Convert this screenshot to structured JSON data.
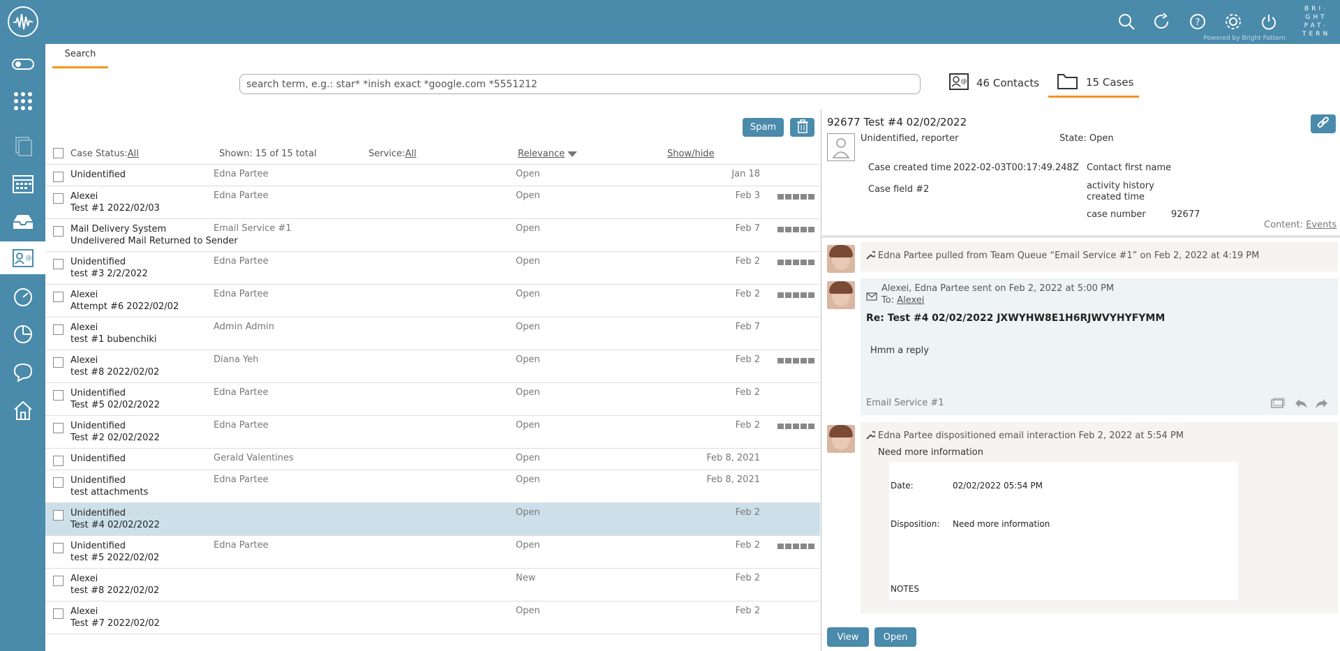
{
  "topbar": {
    "icons": [
      "search-icon",
      "refresh-icon",
      "help-icon",
      "settings-icon",
      "power-icon"
    ],
    "powered_by": "Powered by Bright Pattern",
    "brand_lines": [
      "BRI",
      "·",
      "GHT",
      "PAT",
      "·",
      "TERN"
    ],
    "brand_text": "BRI·GHT PAT·TERN"
  },
  "sidebar": {
    "items": [
      "toggle-icon",
      "apps-grid-icon",
      "documents-icon",
      "calendar-icon",
      "inbox-icon",
      "contacts-icon",
      "dashboard-icon",
      "reports-icon",
      "chat-icon",
      "home-icon"
    ]
  },
  "tabs": {
    "search": "Search"
  },
  "search": {
    "placeholder": "search term, e.g.: star* *inish exact *google.com *5551212"
  },
  "counts": {
    "contacts": "46 Contacts",
    "cases": "15 Cases"
  },
  "toolbar": {
    "spam": "Spam"
  },
  "list_header": {
    "case_status_label": "Case Status:",
    "case_status_value": "All",
    "shown": "Shown: 15 of 15 total",
    "service_label": "Service:",
    "service_value": "All",
    "relevance": "Relevance",
    "show_hide": "Show/hide"
  },
  "rows": [
    {
      "name": "Unidentified",
      "subject": "",
      "agent": "Edna Partee",
      "status": "Open",
      "date": "Jan 18",
      "bars": false
    },
    {
      "name": "Alexei",
      "subject": "Test #1 2022/02/03",
      "agent": "Edna Partee",
      "status": "Open",
      "date": "Feb 3",
      "bars": true
    },
    {
      "name": "Mail Delivery System",
      "subject": "Undelivered Mail Returned to Sender",
      "agent": "Email Service #1",
      "status": "Open",
      "date": "Feb 7",
      "bars": true
    },
    {
      "name": "Unidentified",
      "subject": "test #3 2/2/2022",
      "agent": "Edna Partee",
      "status": "Open",
      "date": "Feb 2",
      "bars": true
    },
    {
      "name": "Alexei",
      "subject": "Attempt #6 2022/02/02",
      "agent": "Edna Partee",
      "status": "Open",
      "date": "Feb 2",
      "bars": true
    },
    {
      "name": "Alexei",
      "subject": "test #1 bubenchiki",
      "agent": "Admin Admin",
      "status": "Open",
      "date": "Feb 7",
      "bars": false
    },
    {
      "name": "Alexei",
      "subject": "test #8 2022/02/02",
      "agent": "Diana Yeh",
      "status": "Open",
      "date": "Feb 2",
      "bars": true
    },
    {
      "name": "Unidentified",
      "subject": "Test #5 02/02/2022",
      "agent": "Edna Partee",
      "status": "Open",
      "date": "Feb 2",
      "bars": false
    },
    {
      "name": "Unidentified",
      "subject": "Test #2 02/02/2022",
      "agent": "Edna Partee",
      "status": "Open",
      "date": "Feb 2",
      "bars": true
    },
    {
      "name": "Unidentified",
      "subject": "",
      "agent": "Gerald Valentines",
      "status": "Open",
      "date": "Feb 8, 2021",
      "bars": false
    },
    {
      "name": "Unidentified",
      "subject": "test attachments",
      "agent": "Edna Partee",
      "status": "Open",
      "date": "Feb 8, 2021",
      "bars": false
    },
    {
      "name": "Unidentified",
      "subject": "Test #4 02/02/2022",
      "agent": "",
      "status": "Open",
      "date": "Feb 2",
      "bars": false,
      "selected": true
    },
    {
      "name": "Unidentified",
      "subject": "test #5 2022/02/02",
      "agent": "Edna Partee",
      "status": "Open",
      "date": "Feb 2",
      "bars": true
    },
    {
      "name": "Alexei",
      "subject": "test #8 2022/02/02",
      "agent": "",
      "status": "New",
      "date": "Feb 2",
      "bars": false
    },
    {
      "name": "Alexei",
      "subject": "Test #7 2022/02/02",
      "agent": "",
      "status": "Open",
      "date": "Feb 2",
      "bars": false
    }
  ],
  "detail": {
    "title": "92677  Test #4 02/02/2022",
    "contact": "Unidentified, reporter",
    "state": "State: Open",
    "created_label": "Case created time",
    "created_value": "2022-02-03T00:17:49.248Z",
    "case_field2": "Case field #2",
    "first_name": "Contact first name",
    "activity_history_1": "activity history",
    "activity_history_2": "created time",
    "case_number_label": "case number",
    "case_number_value": "92677",
    "content_label": "Content: ",
    "content_value": "Events",
    "events": {
      "e1": "Edna Partee pulled from Team Queue “Email Service #1” on Feb 2, 2022 at 4:19 PM",
      "e2_sender": "Alexei, Edna Partee sent on Feb 2, 2022 at 5:00 PM",
      "e2_to_label": "To: ",
      "e2_to_value": "Alexei",
      "e2_subject": "Re: Test #4 02/02/2022 JXWYHW8E1H6RJWVYHYFYMM",
      "e2_body": "Hmm a reply",
      "e2_service": "Email Service #1",
      "e3": "Edna Partee dispositioned email interaction Feb 2, 2022 at 5:54 PM",
      "e3_disposition": "Need more information",
      "date_label": "Date:",
      "date_value": "02/02/2022 05:54 PM",
      "disp_label": "Disposition:",
      "disp_value": "Need more information",
      "notes": "NOTES"
    },
    "view_button": "View",
    "open_button": "Open"
  }
}
